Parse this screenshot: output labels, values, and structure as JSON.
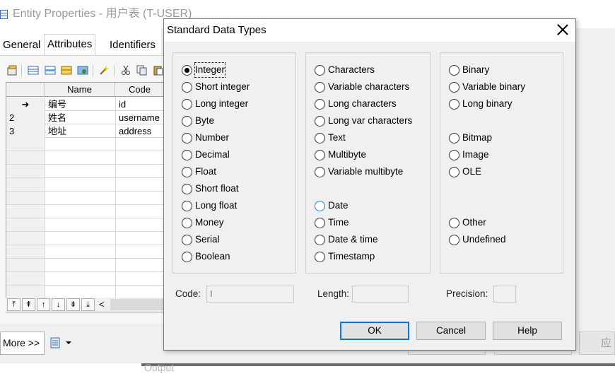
{
  "background_window": {
    "title": "Entity Properties - 用户表 (T-USER)",
    "tabs": [
      {
        "label": "General",
        "active": false
      },
      {
        "label": "Attributes",
        "active": true
      },
      {
        "label": "Identifiers",
        "active": false
      }
    ],
    "grid": {
      "columns": [
        "Name",
        "Code"
      ],
      "rows": [
        {
          "num": "",
          "marker": "➜",
          "name": "编号",
          "code": "id"
        },
        {
          "num": "2",
          "marker": "",
          "name": "姓名",
          "code": "username"
        },
        {
          "num": "3",
          "marker": "",
          "name": "地址",
          "code": "address"
        }
      ]
    },
    "nav_buttons": [
      "⤒",
      "⇞",
      "↑",
      "↓",
      "⇟",
      "⤓"
    ],
    "scroll_left": "<",
    "more_button": "More >>",
    "right_button_partial": "应用",
    "bottom_text": "Output"
  },
  "dialog": {
    "title": "Standard Data Types",
    "group1": [
      {
        "label": "Integer",
        "checked": true,
        "focused": true
      },
      {
        "label": "Short integer"
      },
      {
        "label": "Long integer"
      },
      {
        "label": "Byte"
      },
      {
        "label": "Number"
      },
      {
        "label": "Decimal"
      },
      {
        "label": "Float"
      },
      {
        "label": "Short float"
      },
      {
        "label": "Long float"
      },
      {
        "label": "Money"
      },
      {
        "label": "Serial"
      },
      {
        "label": "Boolean"
      }
    ],
    "group2": [
      {
        "label": "Characters"
      },
      {
        "label": "Variable characters"
      },
      {
        "label": "Long characters"
      },
      {
        "label": "Long var characters"
      },
      {
        "label": "Text"
      },
      {
        "label": "Multibyte"
      },
      {
        "label": "Variable multibyte"
      },
      {
        "label": "Date",
        "hover": true
      },
      {
        "label": "Time"
      },
      {
        "label": "Date & time"
      },
      {
        "label": "Timestamp"
      }
    ],
    "group3": [
      {
        "label": "Binary"
      },
      {
        "label": "Variable binary"
      },
      {
        "label": "Long binary"
      },
      {
        "label": "Bitmap"
      },
      {
        "label": "Image"
      },
      {
        "label": "OLE"
      },
      {
        "label": "Other"
      },
      {
        "label": "Undefined"
      }
    ],
    "fields": {
      "code_label": "Code:",
      "code_value": "I",
      "length_label": "Length:",
      "length_value": "",
      "precision_label": "Precision:",
      "precision_value": ""
    },
    "buttons": {
      "ok": "OK",
      "cancel": "Cancel",
      "help": "Help"
    }
  },
  "colors": {
    "accent": "#0078d7",
    "dialog_bg": "#f0f0f0"
  }
}
